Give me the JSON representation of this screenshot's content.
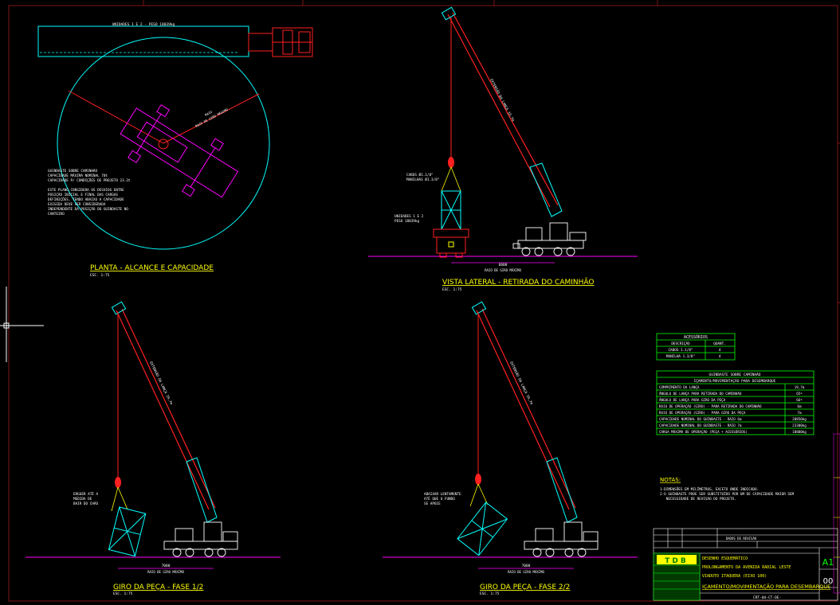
{
  "views": {
    "plan": {
      "title": "PLANTA - ALCANCE E CAPACIDADE",
      "scale": "ESC. 1:75",
      "truck_label": "UNIDADES 1 E 2 - PESO 18039kg",
      "radius_label_1": "RAIO",
      "radius_label_2": "RAIO DE GIRO MÁXIMO",
      "notes": [
        "GUINDASTE SOBRE CAMINHÃO",
        "CAPACIDADE MÁXIMA NOMINAL 70t",
        "CAPACIDADE P/ CONDIÇÕES DE PROJETO 23.3t",
        "",
        "ESTE PLANO CONSIDERA OS DESVIOS ENTRE",
        "POSIÇÃO INICIAL E FINAL DAS CARGAS",
        "DEFINIÇÕES, TENDO ABAIXO A CAPACIDADE",
        "EXIGIDA DEVE SER CONSIDERADA",
        "INDEPENDENTE DA POSIÇÃO DO GUINDASTE NO",
        "CANTEIRO"
      ]
    },
    "lateral": {
      "title": "VISTA LATERAL - RETIRADA DO CAMINHÃO",
      "scale": "ESC. 1:75",
      "boom_label": "EXTENSÃO DA LANÇA 19,7m",
      "cable_label_1": "CABOS Ø1.1/8\"",
      "cable_label_2": "MANILHAS Ø1.3/8\"",
      "load_label_1": "UNIDADES 1 E 2",
      "load_label_2": "PESO 18039kg",
      "dim_value": "6000",
      "dim_label": "RAIO DE GIRO MÁXIMO"
    },
    "phase1": {
      "title": "GIRO DA PEÇA - FASE 1/2",
      "scale": "ESC. 1:75",
      "boom_label": "EXTENSÃO DA LANÇA 19,7m",
      "note_1": "ERGUER ATÉ A",
      "note_2": "MEDIDA DE",
      "note_3": "BAIR DO CHÃO",
      "dim_value": "7000",
      "dim_label": "RAIO DE GIRO MÁXIMO"
    },
    "phase2": {
      "title": "GIRO DA PEÇA - FASE 2/2",
      "scale": "ESC. 1:75",
      "boom_label": "EXTENSÃO DA LANÇA 19,7m",
      "note_1": "ABAIXAR LENTAMENTE",
      "note_2": "ATÉ QUE O FUNDO",
      "note_3": "SE APOIE",
      "dim_value": "7000",
      "dim_label": "RAIO DE GIRO MÁXIMO"
    }
  },
  "accessories_table": {
    "title": "ACESSÓRIOS",
    "headers": [
      "DESCRIÇÃO",
      "QUANT."
    ],
    "rows": [
      [
        "CABOS 1.1/8\"",
        "4"
      ],
      [
        "MANILHA 1.3/8\"",
        "4"
      ]
    ]
  },
  "crane_table": {
    "title": "GUINDASTE SOBRE CAMINHÃO",
    "subtitle": "IÇAMENTO/MOVIMENTAÇÃO PARA DESEMBARQUE",
    "rows": [
      [
        "COMPRIMENTO DA LANÇA",
        "19,7m"
      ],
      [
        "ÂNGULO DE LANÇA PARA RETIRADA DO CAMINHÃO",
        "65º"
      ],
      [
        "ÂNGULO DE LANÇA PARA GIRO DA PEÇA",
        "66º"
      ],
      [
        "RAIO DE OPERAÇÃO (GIRO) - PARA RETIRADA DO CAMINHÃO",
        "6m"
      ],
      [
        "RAIO DE OPERAÇÃO (GIRO) - PARA GIRO DA PEÇA",
        "7m"
      ],
      [
        "CAPACIDADE NOMINAL DO GUINDASTE - RAIO 6m",
        "28850kg"
      ],
      [
        "CAPACIDADE NOMINAL DO GUINDASTE - RAIO 7m",
        "23300kg"
      ],
      [
        "CARGA MÁXIMA DE OPERAÇÃO (PEÇA + ACESSÓRIOS)",
        "18800kg"
      ]
    ]
  },
  "notes": {
    "title": "NOTAS:",
    "lines": [
      "1-DIMENSÕES EM MILÍMETROS, EXCETO ONDE INDICADO.",
      "2-O GUINDASTE PODE SER SUBSTITUÍDO POR UM DE CAPACIDADE MAIOR SEM",
      "   NECESSIDADE DE REVISÃO DO PROJETO."
    ]
  },
  "title_block": {
    "logo": "TDB",
    "rev_header": "DADOS DE REVISÃO",
    "line_1": "DESENHO ESQUEMÁTICO",
    "line_2": "PROLONGAMENTO DA AVENIDA RADIAL LESTE",
    "line_3": "VIADUTO ITAQUERA (EIXO 100)",
    "line_4": "IÇAMENTO/MOVIMENTAÇÃO PARA DESEMBARQUE",
    "sheet_size": "A1",
    "revision": "00",
    "code": "CRT-04-CT-DE-"
  },
  "colors": {
    "cyan": "#00ffff",
    "red": "#ff2020",
    "magenta": "#ff00ff",
    "yellow": "#ffff00",
    "green": "#00ff00",
    "white": "#ffffff"
  }
}
